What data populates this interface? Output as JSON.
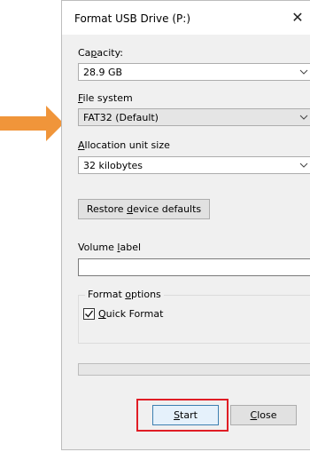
{
  "dialog": {
    "title": "Format USB Drive (P:)",
    "close_icon": "close-icon"
  },
  "capacity": {
    "label_pre": "Ca",
    "label_key": "p",
    "label_post": "acity:",
    "value": "28.9 GB"
  },
  "file_system": {
    "label_pre": "",
    "label_key": "F",
    "label_post": "ile system",
    "value": "FAT32 (Default)"
  },
  "allocation": {
    "label_pre": "",
    "label_key": "A",
    "label_post": "llocation unit size",
    "value": "32 kilobytes"
  },
  "restore_button": {
    "pre": "Restore ",
    "key": "d",
    "post": "evice defaults"
  },
  "volume_label": {
    "pre": "Volume ",
    "key": "l",
    "post": "abel",
    "value": ""
  },
  "format_options": {
    "legend_pre": "Format ",
    "legend_key": "o",
    "legend_post": "ptions",
    "quick_format": {
      "pre": "",
      "key": "Q",
      "post": "uick Format",
      "checked": true
    }
  },
  "progress": {
    "value": 0
  },
  "buttons": {
    "start": {
      "pre": "",
      "key": "S",
      "post": "tart"
    },
    "close": {
      "pre": "",
      "key": "C",
      "post": "lose"
    }
  },
  "annotations": {
    "arrow_color": "#f0953a",
    "highlight_color": "#e01d25"
  }
}
